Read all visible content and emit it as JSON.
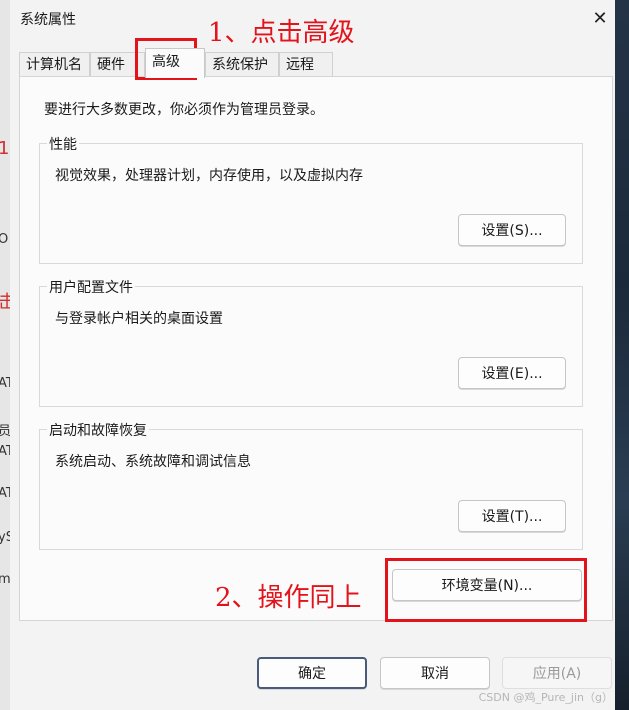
{
  "window": {
    "title": "系统属性",
    "close_glyph": "✕"
  },
  "tabs": [
    {
      "label": "计算机名",
      "active": false
    },
    {
      "label": "硬件",
      "active": false
    },
    {
      "label": "高级",
      "active": true
    },
    {
      "label": "系统保护",
      "active": false
    },
    {
      "label": "远程",
      "active": false
    }
  ],
  "advanced": {
    "intro": "要进行大多数更改，你必须作为管理员登录。",
    "performance": {
      "title": "性能",
      "description": "视觉效果，处理器计划，内存使用，以及虚拟内存",
      "button": "设置(S)..."
    },
    "user_profiles": {
      "title": "用户配置文件",
      "description": "与登录帐户相关的桌面设置",
      "button": "设置(E)..."
    },
    "startup_recovery": {
      "title": "启动和故障恢复",
      "description": "系统启动、系统故障和调试信息",
      "button": "设置(T)..."
    },
    "env_button": "环境变量(N)..."
  },
  "footer": {
    "ok": "确定",
    "cancel": "取消",
    "apply": "应用(A)"
  },
  "annotations": {
    "step1": "1、点击高级",
    "step2": "2、操作同上",
    "color": "#e3131b"
  },
  "watermark": "CSDN @鸡_Pure_jin（g）",
  "background_fragments": {
    "frag1": "1",
    "frag2": "O",
    "frag3": "击",
    "frag4": "AT",
    "frag5": "员",
    "frag6": "AT",
    "frag7": "AT",
    "frag8": "yS",
    "frag9": "m"
  }
}
